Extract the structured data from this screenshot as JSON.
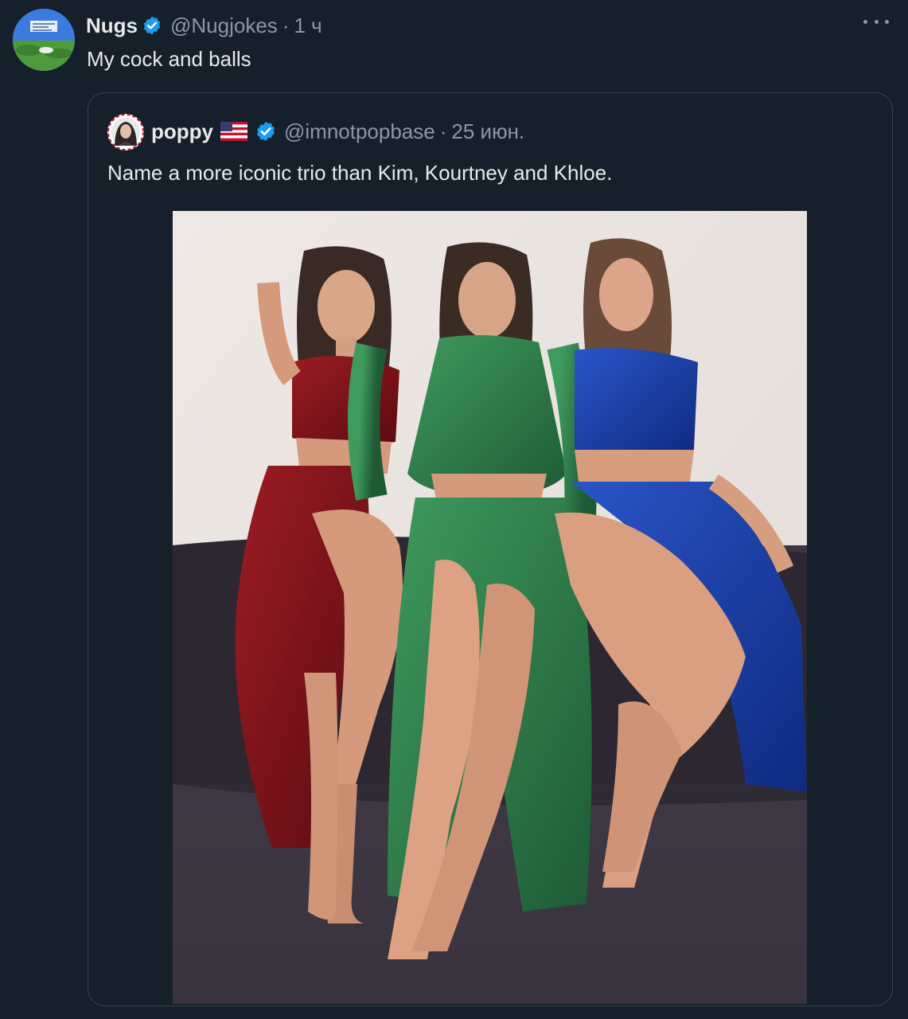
{
  "tweet": {
    "display_name": "Nugs",
    "handle": "@Nugjokes",
    "separator": "·",
    "time": "1 ч",
    "text": "My cock and balls",
    "more_icon": "more-horizontal-icon",
    "verified_icon": "verified-badge-icon"
  },
  "quote": {
    "display_name": "poppy",
    "flag_icon": "us-flag-icon",
    "verified_icon": "verified-badge-icon",
    "handle": "@imnotpopbase",
    "separator": "·",
    "time": "25 июн.",
    "text": "Name a more iconic trio than Kim, Kourtney and Khloe."
  },
  "colors": {
    "background": "#15202b",
    "border": "#38444d",
    "verified": "#1d9bf0",
    "primary_text": "#e7e9ea",
    "secondary_text": "#8b98a5"
  }
}
